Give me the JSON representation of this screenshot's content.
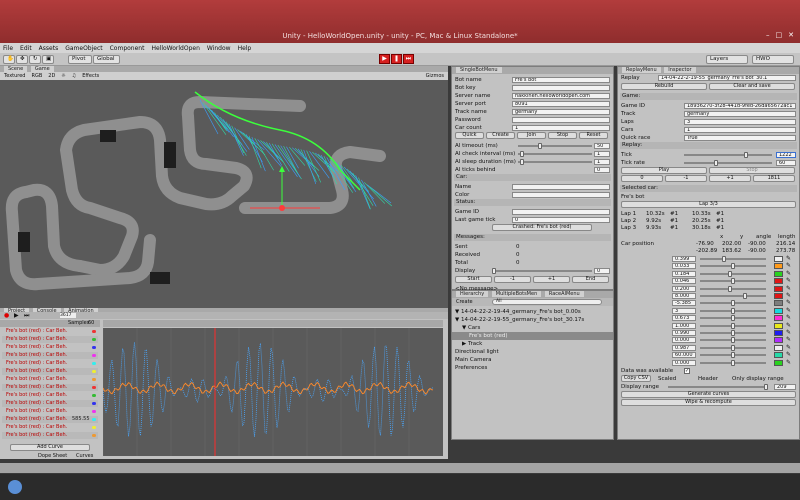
{
  "window": {
    "title": "Unity - HelloWorldOpen.unity - unity - PC, Mac & Linux Standalone*"
  },
  "menu": [
    "File",
    "Edit",
    "Assets",
    "GameObject",
    "Component",
    "HelloWorldOpen",
    "Window",
    "Help"
  ],
  "toolbar": {
    "pivot": "Pivot",
    "global": "Global",
    "layers": "Layers",
    "layout": "HWO"
  },
  "scene": {
    "tab_scene": "Scene",
    "tab_game": "Game",
    "shading": "Textured",
    "rgb": "RGB",
    "mode2d": "2D",
    "effects": "Effects",
    "gizmos": "Gizmos"
  },
  "single_bot": {
    "tab": "SingleBotMenu",
    "fields": [
      {
        "label": "Bot name",
        "value": "Fre's bot"
      },
      {
        "label": "Bot key",
        "value": ""
      },
      {
        "label": "Server name",
        "value": "hakkinen.helloworldopen.com"
      },
      {
        "label": "Server port",
        "value": "8091"
      },
      {
        "label": "Track name",
        "value": "germany"
      },
      {
        "label": "Password",
        "value": ""
      },
      {
        "label": "Car count",
        "value": "1"
      }
    ],
    "buttons": [
      "Quick",
      "Create",
      "Join",
      "Stop",
      "Reset"
    ],
    "ai": [
      {
        "label": "AI timeout (ms)",
        "value": "50"
      },
      {
        "label": "AI check interval (ms)",
        "value": "1"
      },
      {
        "label": "AI sleep duration (ms)",
        "value": "1"
      },
      {
        "label": "AI ticks behind",
        "value": "0"
      }
    ],
    "car_header": "Car:",
    "car_fields": [
      "Name",
      "Color"
    ],
    "status_header": "Status:",
    "status_fields": [
      {
        "label": "Game ID",
        "value": ""
      },
      {
        "label": "Last game tick",
        "value": "0"
      }
    ],
    "crashed": "Crashed: Fre's bot (red)",
    "messages_header": "Messages:",
    "messages": [
      {
        "label": "Sent",
        "value": "0"
      },
      {
        "label": "Received",
        "value": "0"
      },
      {
        "label": "Total",
        "value": "0"
      }
    ],
    "display_label": "Display",
    "display_value": "0",
    "nav_buttons": [
      "Start",
      "-1",
      "+1",
      "End"
    ],
    "no_message": "<No message>"
  },
  "hierarchy": {
    "tabs": [
      "Hierarchy",
      "MultipleBotsMen",
      "RaceAIMenu"
    ],
    "create": "Create",
    "search": "All",
    "items": [
      "▼ 14-04-22-2-19-44_germany_Fre's bot_0.00s",
      "▼ 14-04-22-2-19-55_germany_Fre's bot_30.17s",
      "    ▼ Cars",
      "        Fre's bot (red)",
      "    ▶ Track",
      "Directional light",
      "Main Camera",
      "Preferences"
    ]
  },
  "replay": {
    "tabs": [
      "ReplayMenu",
      "Inspector"
    ],
    "replay_label": "Replay",
    "replay_file": "14-04-22-2-19-55_germany_Fre's bot_30.1",
    "rebuild": "Rebuild",
    "clear_save": "Clear and save",
    "game_header": "Game:",
    "game": [
      {
        "label": "Game ID",
        "value": "18936270-3f28-441d-9fed-26da65672ac1"
      },
      {
        "label": "Track",
        "value": "germany"
      },
      {
        "label": "Laps",
        "value": "3"
      },
      {
        "label": "Cars",
        "value": "1"
      },
      {
        "label": "Quick race",
        "value": "True"
      }
    ],
    "replay_header": "Replay:",
    "tick_label": "Tick",
    "tick_value": "1222",
    "tick_rate_label": "Tick rate",
    "tick_rate_value": "60",
    "play": "Play",
    "stop": "Stop",
    "step_buttons": [
      "0",
      "-1",
      "+1",
      "1811"
    ],
    "selected_header": "Selected car:",
    "selected_car": "Fre's bot",
    "lap_label": "Lap 3/3",
    "laps": [
      {
        "lap": "Lap 1",
        "t1": "10.32s",
        "r1": "#1",
        "t2": "10.33s",
        "r2": "#1"
      },
      {
        "lap": "Lap 2",
        "t1": "9.92s",
        "r1": "#1",
        "t2": "20.25s",
        "r2": "#1"
      },
      {
        "lap": "Lap 3",
        "t1": "9.93s",
        "r1": "#1",
        "t2": "30.18s",
        "r2": "#1"
      }
    ],
    "pos_headers": [
      "x",
      "y",
      "angle",
      "length"
    ],
    "car_position_label": "Car position",
    "pos_rows": [
      [
        "-76.90",
        "202.00",
        "-90.00",
        "216.14"
      ],
      [
        "-202.89",
        "183.62",
        "-90.00",
        "273.78"
      ]
    ],
    "sliders": [
      {
        "value": "0.399",
        "color": "#f0f0f0",
        "level": 0.36
      },
      {
        "value": "0.033",
        "color": "#ff9a1a",
        "level": 0.5
      },
      {
        "value": "0.184",
        "color": "#29d11f",
        "level": 0.45
      },
      {
        "value": "0.046",
        "color": "#e01515",
        "level": 0.5
      },
      {
        "value": "0.200",
        "color": "#e01515",
        "level": 0.45
      },
      {
        "value": "8.000",
        "color": "#e01515",
        "level": 0.7
      },
      {
        "value": "-5.385",
        "color": "#7d7d7d",
        "level": 0.5
      },
      {
        "value": "3",
        "color": "#16d9e0",
        "level": 0.5
      },
      {
        "value": "0.673",
        "color": "#ff2bd4",
        "level": 0.5
      },
      {
        "value": "1.000",
        "color": "#e8e81a",
        "level": 0.5
      },
      {
        "value": "0.990",
        "color": "#1d1df0",
        "level": 0.5
      },
      {
        "value": "0.000",
        "color": "#b12bff",
        "level": 0.5
      },
      {
        "value": "0.987",
        "color": "#f0f0f0",
        "level": 0.5
      },
      {
        "value": "60.000",
        "color": "#25d9a8",
        "level": 0.5
      },
      {
        "value": "0.000",
        "color": "#29d11f",
        "level": 0.5
      }
    ],
    "data_available": "Data was available",
    "copy_csv": "Copy CSV",
    "scaled": "Scaled",
    "header_cb": "Header",
    "only_display": "Only display range",
    "display_range_label": "Display range",
    "display_range_value": "209",
    "generate": "Generate curves",
    "wipe": "Wipe & recompute"
  },
  "animation": {
    "tabs": [
      "Project",
      "Console",
      "Animation"
    ],
    "celldata": "CelData",
    "samples_label": "Samples",
    "samples_value": "60",
    "time_field": "3617",
    "rows": [
      "Fre's bot (red) : Car Beh.",
      "Fre's bot (red) : Car Beh.",
      "Fre's bot (red) : Car Beh.",
      "Fre's bot (red) : Car Beh.",
      "Fre's bot (red) : Car Beh.",
      "Fre's bot (red) : Car Beh.",
      "Fre's bot (red) : Car Beh.",
      "Fre's bot (red) : Car Beh.",
      "Fre's bot (red) : Car Beh.",
      "Fre's bot (red) : Car Beh.",
      "Fre's bot (red) : Car Beh.",
      "Fre's bot (red) : Car Beh.",
      "Fre's bot (red) : Car Beh.",
      "Fre's bot (red) : Car Beh."
    ],
    "row_values": [
      "",
      "",
      "",
      "",
      "",
      "",
      "",
      "",
      "",
      "",
      "",
      "585.55",
      "",
      ""
    ],
    "add_curve": "Add Curve",
    "dope": "Dope Sheet",
    "curves": "Curves"
  }
}
